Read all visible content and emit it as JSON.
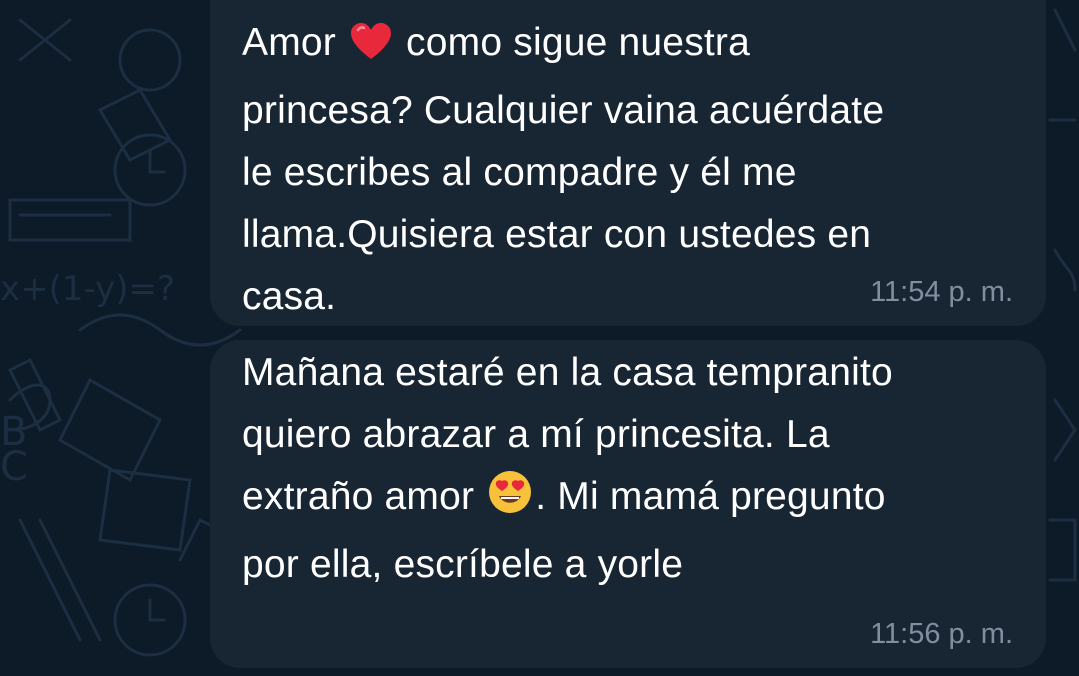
{
  "messages": [
    {
      "parts": [
        "Amor ",
        " como sigue nuestra\nprincesa? Cualquier vaina acuérdate\nle escribes al compadre y él me\nllama.Quisiera estar con ustedes en\ncasa."
      ],
      "emoji": "red-heart-icon",
      "time": "11:54 p. m."
    },
    {
      "parts": [
        "Mañana estaré en la casa tempranito\nquiero abrazar a mí princesita. La\nextraño amor ",
        ". Mi mamá pregunto\npor ella, escríbele a yorle"
      ],
      "emoji": "heart-eyes-face-icon",
      "time": "11:56 p. m."
    }
  ],
  "colors": {
    "background": "#0d1a27",
    "bubble": "#182533",
    "text": "#ffffff",
    "time": "#7f8f9f"
  }
}
